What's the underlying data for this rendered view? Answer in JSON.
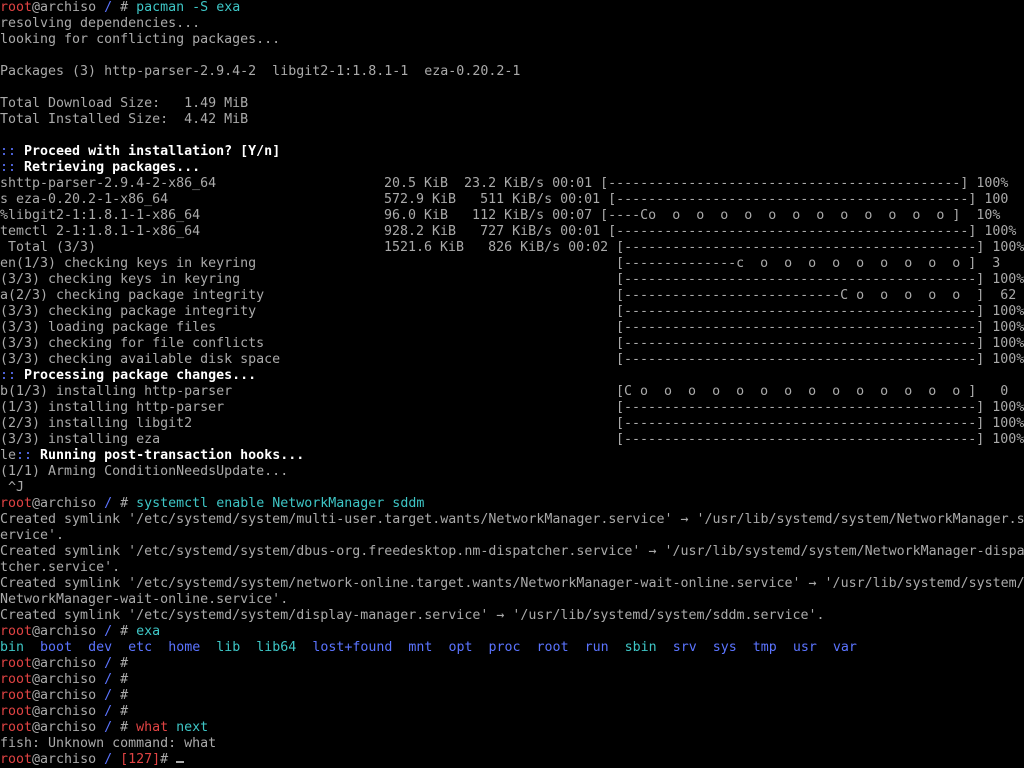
{
  "colors": {
    "background": "#000000",
    "text": "#aaaaaa",
    "prompt_user": "#e04343",
    "prompt_path": "#5b74ff",
    "command": "#3ec6c6",
    "bold": "#ffffff"
  },
  "prompt": {
    "user": "root",
    "host": "@archiso",
    "path": "/",
    "symbol": "#"
  },
  "lines": [
    {
      "type": "prompt",
      "cmd": "pacman",
      "args": " -S exa"
    },
    {
      "type": "text",
      "text": "resolving dependencies..."
    },
    {
      "type": "text",
      "text": "looking for conflicting packages..."
    },
    {
      "type": "blank"
    },
    {
      "type": "text",
      "text": "Packages (3) http-parser-2.9.4-2  libgit2-1:1.8.1-1  eza-0.20.2-1"
    },
    {
      "type": "blank"
    },
    {
      "type": "text",
      "text": "Total Download Size:   1.49 MiB"
    },
    {
      "type": "text",
      "text": "Total Installed Size:  4.42 MiB"
    },
    {
      "type": "blank"
    },
    {
      "type": "colon",
      "marker": "::",
      "text": " Proceed with installation? [Y/n]"
    },
    {
      "type": "colon",
      "marker": "::",
      "text": " Retrieving packages..."
    },
    {
      "type": "progress",
      "left": "shttp-parser-2.9.4-2-x86_64",
      "right": "                20.5 KiB  23.2 KiB/s 00:01 [--------------------------------------------] 100%"
    },
    {
      "type": "progress",
      "left": "s eza-0.20.2-1-x86_64",
      "right": "                      572.9 KiB   511 KiB/s 00:01 [--------------------------------------------] 100"
    },
    {
      "type": "progress",
      "left": "%libgit2-1:1.8.1-1-x86_64",
      "right": "                   96.0 KiB   112 KiB/s 00:07 [----Co  o  o  o  o  o  o  o  o  o  o  o  o ]  10%"
    },
    {
      "type": "progress",
      "left": "temctl 2-1:1.8.1-1-x86_64",
      "right": "                 928.2 KiB   727 KiB/s 00:01 [--------------------------------------------] 100%"
    },
    {
      "type": "progress",
      "left": " Total (3/3)",
      "right": "                               1521.6 KiB   826 KiB/s 00:02 [--------------------------------------------] 100%"
    },
    {
      "type": "progress",
      "left": "en(1/3) checking keys in keyring",
      "right": "                                               [--------------c  o  o  o  o  o  o  o  o  o ]  3"
    },
    {
      "type": "progress",
      "left": "(3/3) checking keys in keyring",
      "right": "                                               [--------------------------------------------] 100%"
    },
    {
      "type": "progress",
      "left": "a(2/3) checking package integrity",
      "right": "                                             [---------------------------C o  o  o  o  o  ]  62"
    },
    {
      "type": "progress",
      "left": "(3/3) checking package integrity",
      "right": "                                              [--------------------------------------------] 100%"
    },
    {
      "type": "progress",
      "left": "(3/3) loading package files",
      "right": "                                                   [--------------------------------------------] 100%"
    },
    {
      "type": "progress",
      "left": "(3/3) checking for file conflicts",
      "right": "                                             [--------------------------------------------] 100%"
    },
    {
      "type": "progress",
      "left": "(3/3) checking available disk space",
      "right": "                                           [--------------------------------------------] 100%"
    },
    {
      "type": "colon",
      "marker": "::",
      "text": " Processing package changes..."
    },
    {
      "type": "progress",
      "left": "b(1/3) installing http-parser",
      "right": "                                                 [C o  o  o  o  o  o  o  o  o  o  o  o  o  o ]   0"
    },
    {
      "type": "progress",
      "left": "(1/3) installing http-parser",
      "right": "                                                  [--------------------------------------------] 100%"
    },
    {
      "type": "progress",
      "left": "(2/3) installing libgit2",
      "right": "                                                      [--------------------------------------------] 100%"
    },
    {
      "type": "progress",
      "left": "(3/3) installing eza",
      "right": "                                                          [--------------------------------------------] 100%"
    },
    {
      "type": "colon",
      "prefix": "le",
      "marker": "::",
      "text": " Running post-transaction hooks..."
    },
    {
      "type": "text",
      "text": "(1/1) Arming ConditionNeedsUpdate..."
    },
    {
      "type": "text",
      "text": " ^J"
    },
    {
      "type": "prompt",
      "cmd": "systemctl",
      "args": " enable NetworkManager sddm"
    },
    {
      "type": "text",
      "text": "Created symlink '/etc/systemd/system/multi-user.target.wants/NetworkManager.service' → '/usr/lib/systemd/system/NetworkManager.s"
    },
    {
      "type": "text",
      "text": "ervice'."
    },
    {
      "type": "text",
      "text": "Created symlink '/etc/systemd/system/dbus-org.freedesktop.nm-dispatcher.service' → '/usr/lib/systemd/system/NetworkManager-dispa"
    },
    {
      "type": "text",
      "text": "tcher.service'."
    },
    {
      "type": "text",
      "text": "Created symlink '/etc/systemd/system/network-online.target.wants/NetworkManager-wait-online.service' → '/usr/lib/systemd/system/"
    },
    {
      "type": "text",
      "text": "NetworkManager-wait-online.service'."
    },
    {
      "type": "text",
      "text": "Created symlink '/etc/systemd/system/display-manager.service' → '/usr/lib/systemd/system/sddm.service'."
    },
    {
      "type": "prompt",
      "cmd": "exa",
      "args": ""
    },
    {
      "type": "ls",
      "items": [
        "bin",
        "boot",
        "dev",
        "etc",
        "home",
        "lib",
        "lib64",
        "lost+found",
        "mnt",
        "opt",
        "proc",
        "root",
        "run",
        "sbin",
        "srv",
        "sys",
        "tmp",
        "usr",
        "var"
      ]
    },
    {
      "type": "prompt",
      "cmd": "",
      "args": ""
    },
    {
      "type": "prompt",
      "cmd": "",
      "args": ""
    },
    {
      "type": "prompt",
      "cmd": "",
      "args": ""
    },
    {
      "type": "prompt",
      "cmd": "",
      "args": ""
    },
    {
      "type": "prompt",
      "cmd": "what",
      "cmdColor": "red",
      "args": " next"
    },
    {
      "type": "text",
      "text": "fish: Unknown command: what"
    },
    {
      "type": "prompt_status",
      "status": "[127]",
      "cursor": true
    }
  ]
}
